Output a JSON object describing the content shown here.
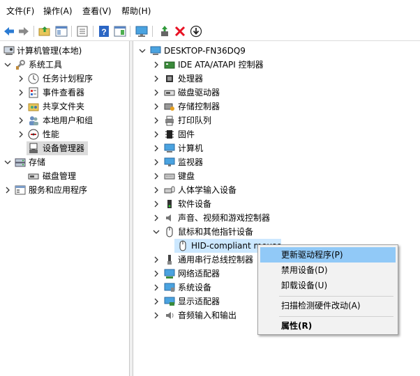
{
  "menubar": {
    "file": "文件(F)",
    "action": "操作(A)",
    "view": "查看(V)",
    "help": "帮助(H)"
  },
  "toolbar": {
    "buttons": [
      "back-arrow-icon",
      "forward-arrow-icon",
      "folder-up-icon",
      "show-hide-tree-icon",
      "properties-icon",
      "help-icon",
      "show-hide-action-pane-icon",
      "computer-monitor-icon",
      "update-driver-icon",
      "uninstall-x-icon",
      "download-arrow-icon"
    ]
  },
  "left_tree": {
    "root": "计算机管理(本地)",
    "system_tools": "系统工具",
    "task_scheduler": "任务计划程序",
    "event_viewer": "事件查看器",
    "shared_folders": "共享文件夹",
    "local_users": "本地用户和组",
    "performance": "性能",
    "device_manager": "设备管理器",
    "storage": "存储",
    "disk_management": "磁盘管理",
    "services_apps": "服务和应用程序"
  },
  "device_tree": {
    "computer": "DESKTOP-FN36DQ9",
    "categories": [
      {
        "label": "IDE ATA/ATAPI 控制器",
        "icon": "ide-controller-icon"
      },
      {
        "label": "处理器",
        "icon": "processor-icon"
      },
      {
        "label": "磁盘驱动器",
        "icon": "disk-drive-icon"
      },
      {
        "label": "存储控制器",
        "icon": "storage-controller-icon"
      },
      {
        "label": "打印队列",
        "icon": "printer-icon"
      },
      {
        "label": "固件",
        "icon": "firmware-icon"
      },
      {
        "label": "计算机",
        "icon": "computer-icon"
      },
      {
        "label": "监视器",
        "icon": "monitor-icon"
      },
      {
        "label": "键盘",
        "icon": "keyboard-icon"
      },
      {
        "label": "人体学输入设备",
        "icon": "hid-icon"
      },
      {
        "label": "软件设备",
        "icon": "software-device-icon"
      },
      {
        "label": "声音、视频和游戏控制器",
        "icon": "sound-icon"
      },
      {
        "label": "鼠标和其他指针设备",
        "icon": "mouse-icon"
      }
    ],
    "mouse_child": "HID-compliant mouse",
    "after": [
      {
        "label": "通用串行总线控制器",
        "icon": "usb-icon"
      },
      {
        "label": "网络适配器",
        "icon": "network-adapter-icon"
      },
      {
        "label": "系统设备",
        "icon": "system-device-icon"
      },
      {
        "label": "显示适配器",
        "icon": "display-adapter-icon"
      },
      {
        "label": "音频输入和输出",
        "icon": "audio-icon"
      }
    ]
  },
  "context_menu": {
    "update_driver": "更新驱动程序(P)",
    "disable_device": "禁用设备(D)",
    "uninstall_device": "卸载设备(U)",
    "scan_hardware": "扫描检测硬件改动(A)",
    "properties": "属性(R)"
  },
  "colors": {
    "highlight": "#91c9f7",
    "selection": "#cce8ff",
    "uninstall_red": "#e81123"
  }
}
